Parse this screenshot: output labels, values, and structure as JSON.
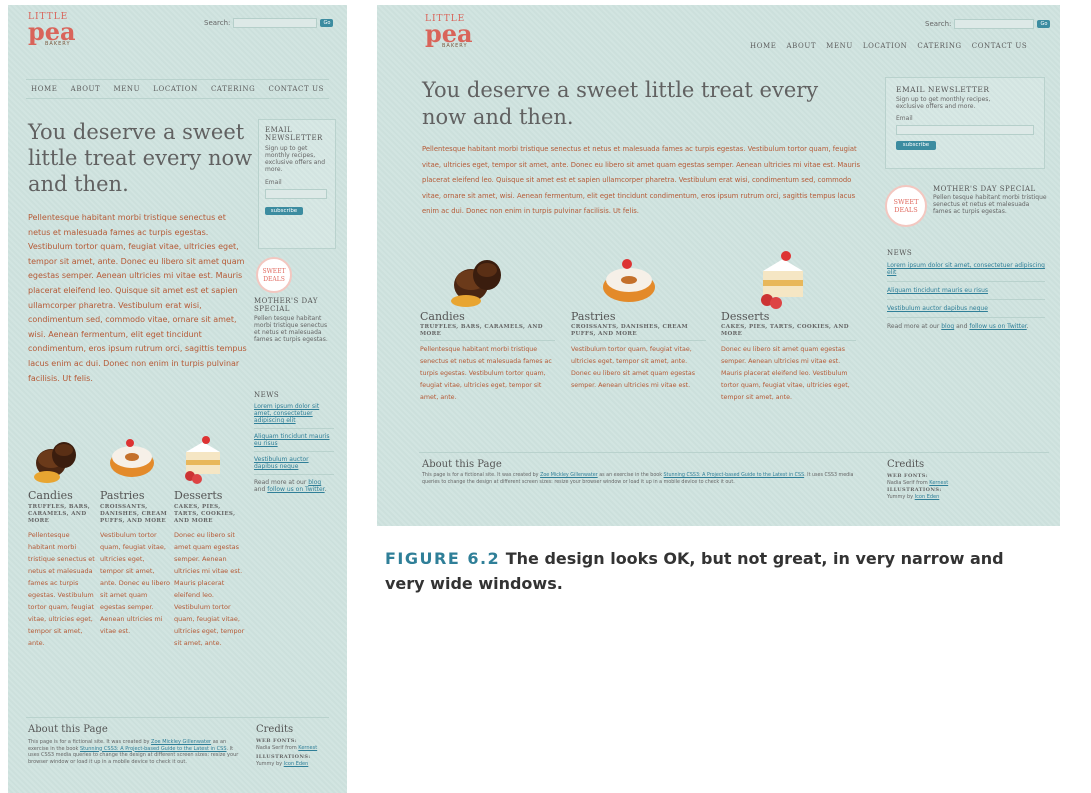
{
  "logo": {
    "little": "LITTLE",
    "pea": "pea",
    "bakery": "BAKERY"
  },
  "search": {
    "label": "Search:",
    "button": "Go"
  },
  "nav": [
    "HOME",
    "ABOUT",
    "MENU",
    "LOCATION",
    "CATERING",
    "CONTACT US"
  ],
  "headline": "You deserve a sweet little treat every now and then.",
  "intro": "Pellentesque habitant morbi tristique senectus et netus et malesuada fames ac turpis egestas. Vestibulum tortor quam, feugiat vitae, ultricies eget, tempor sit amet, ante. Donec eu libero sit amet quam egestas semper. Aenean ultricies mi vitae est. Mauris placerat eleifend leo. Quisque sit amet est et sapien ullamcorper pharetra. Vestibulum erat wisi, condimentum sed, commodo vitae, ornare sit amet, wisi. Aenean fermentum, elit eget tincidunt condimentum, eros ipsum rutrum orci, sagittis tempus lacus enim ac dui. Donec non enim in turpis pulvinar facilisis. Ut felis.",
  "newsletter": {
    "title": "EMAIL NEWSLETTER",
    "text": "Sign up to get monthly recipes, exclusive offers and more.",
    "email_label": "Email",
    "button": "subscribe"
  },
  "badge": {
    "line1": "SWEET",
    "line2": "DEALS"
  },
  "special": {
    "title": "MOTHER'S DAY SPECIAL",
    "text": "Pellen tesque habitant morbi tristique senectus et netus et malesuada fames ac turpis egestas."
  },
  "news": {
    "title": "NEWS",
    "items": [
      "Lorem ipsum dolor sit amet, consectetuer adipiscing elit",
      "Aliquam tincidunt mauris eu risus",
      "Vestibulum auctor dapibus neque"
    ],
    "more_prefix": "Read more at our",
    "blog": "blog",
    "and": "and",
    "twitter": "follow us on Twitter",
    "period": "."
  },
  "treats": [
    {
      "title": "Candies",
      "sub": "TRUFFLES, BARS, CARAMELS, AND MORE",
      "body": "Pellentesque habitant morbi tristique senectus et netus et malesuada fames ac turpis egestas. Vestibulum tortor quam, feugiat vitae, ultricies eget, tempor sit amet, ante."
    },
    {
      "title": "Pastries",
      "sub": "CROISSANTS, DANISHES, CREAM PUFFS, AND MORE",
      "body": "Vestibulum tortor quam, feugiat vitae, ultricies eget, tempor sit amet, ante. Donec eu libero sit amet quam egestas semper. Aenean ultricies mi vitae est."
    },
    {
      "title": "Desserts",
      "sub": "CAKES, PIES, TARTS, COOKIES, AND MORE",
      "body": "Donec eu libero sit amet quam egestas semper. Aenean ultricies mi vitae est. Mauris placerat eleifend leo. Vestibulum tortor quam, feugiat vitae, ultricies eget, tempor sit amet, ante."
    }
  ],
  "about": {
    "title": "About this Page",
    "t1": "This page is for a fictional site. It was created by",
    "author": "Zoe Mickley Gillenwater",
    "t2": "as an exercise in the book",
    "book": "Stunning CSS3: A Project-based Guide to the Latest in CSS",
    "t3": ". It uses CSS3 media queries to change the design at different screen sizes: resize your browser window or load it up in a mobile device to check it out."
  },
  "credits": {
    "title": "Credits",
    "fonts_label": "WEB FONTS:",
    "fonts_prefix": "Nadia Serif from",
    "fonts_link": "Kernest",
    "ill_label": "ILLUSTRATIONS:",
    "ill_prefix": "Yummy by",
    "ill_link": "Icon Eden"
  },
  "caption": {
    "label": "FIGURE 6.2",
    "text": "The design looks OK, but not great, in very narrow and very wide windows."
  }
}
